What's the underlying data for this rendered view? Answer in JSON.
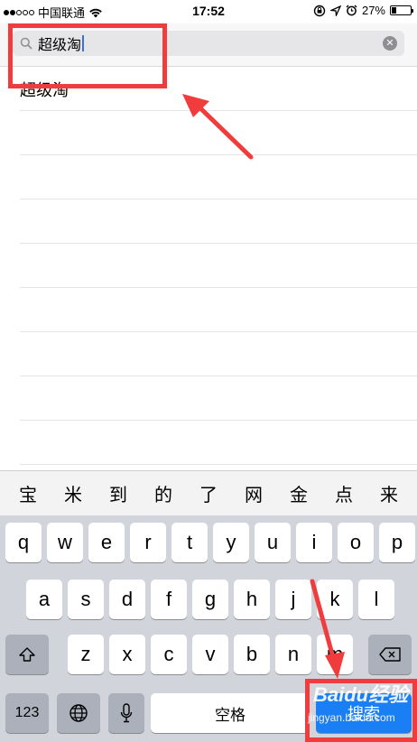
{
  "status_bar": {
    "carrier": "中国联通",
    "time": "17:52",
    "battery_percent": "27%",
    "battery_level": 0.27
  },
  "search": {
    "query": "超级淘"
  },
  "suggestions": [
    {
      "label": "超级淘"
    },
    {
      "label": ""
    },
    {
      "label": ""
    },
    {
      "label": ""
    },
    {
      "label": ""
    },
    {
      "label": ""
    },
    {
      "label": ""
    },
    {
      "label": ""
    },
    {
      "label": ""
    }
  ],
  "candidates": [
    "宝",
    "米",
    "到",
    "的",
    "了",
    "网",
    "金",
    "点",
    "来"
  ],
  "keyboard": {
    "row1": [
      "q",
      "w",
      "e",
      "r",
      "t",
      "y",
      "u",
      "i",
      "o",
      "p"
    ],
    "row2": [
      "a",
      "s",
      "d",
      "f",
      "g",
      "h",
      "j",
      "k",
      "l"
    ],
    "row3": [
      "z",
      "x",
      "c",
      "v",
      "b",
      "n",
      "m"
    ],
    "numbers_label": "123",
    "space_label": "空格",
    "search_label": "搜索"
  },
  "watermark": {
    "brand": "Baidu经验",
    "url": "jingyan.baidu.com"
  },
  "colors": {
    "annotation": "#f03c3c",
    "search_key": "#1a7ef5",
    "caret": "#3b6fe0"
  }
}
